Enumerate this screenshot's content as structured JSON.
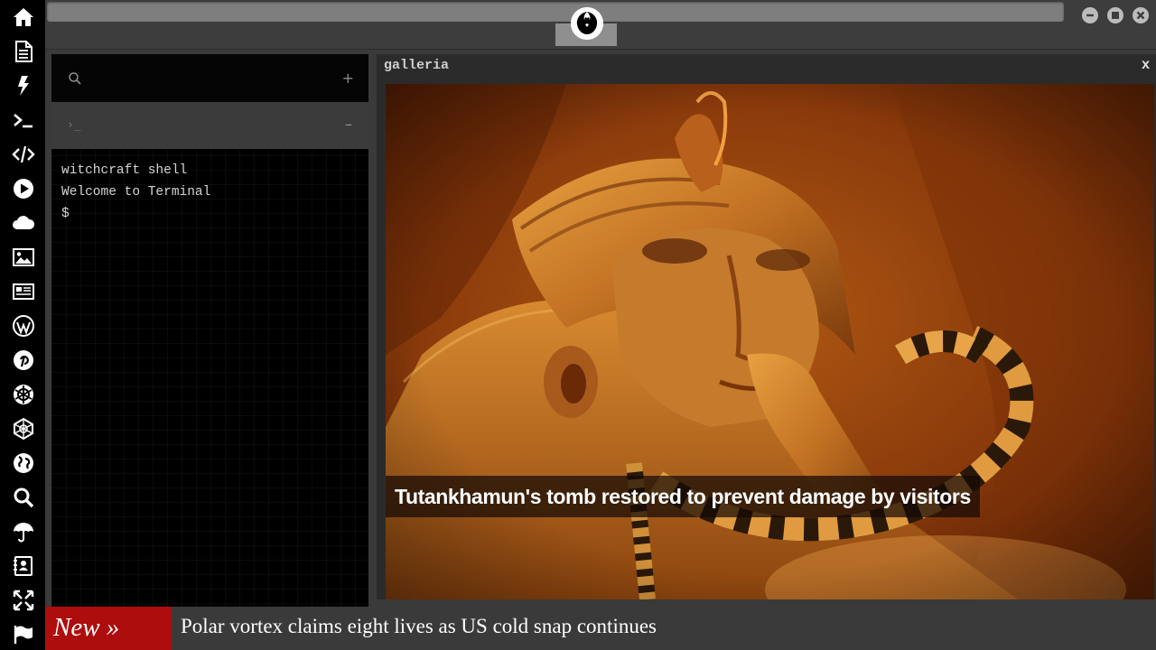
{
  "dock": {
    "icons": [
      "home-icon",
      "document-icon",
      "lightning-icon",
      "terminal-icon",
      "code-icon",
      "play-icon",
      "cloud-icon",
      "image-icon",
      "newspaper-icon",
      "wordpress-icon",
      "pinterest-icon",
      "rebel-alliance-icon",
      "empire-icon",
      "globe-icon",
      "search-icon",
      "umbrella-icon",
      "contact-book-icon",
      "fullscreen-icon",
      "flag-icon"
    ]
  },
  "window_controls": [
    "minimize-icon",
    "maximize-icon",
    "close-icon"
  ],
  "terminal": {
    "search_icon": "search-icon",
    "add_label": "+",
    "tab_prompt": "›_",
    "tab_close_label": "–",
    "lines": [
      "witchcraft shell",
      "Welcome to Terminal",
      "$"
    ]
  },
  "galleria": {
    "title": "galleria",
    "close_label": "x",
    "caption": "Tutankhamun's tomb restored to prevent damage by visitors"
  },
  "ticker": {
    "badge": "New »",
    "headline": "Polar vortex claims eight lives as US cold snap continues"
  },
  "colors": {
    "dock_bg": "#000000",
    "ticker_badge": "#ad0d0d",
    "panel_bg": "#3a3a3a"
  }
}
